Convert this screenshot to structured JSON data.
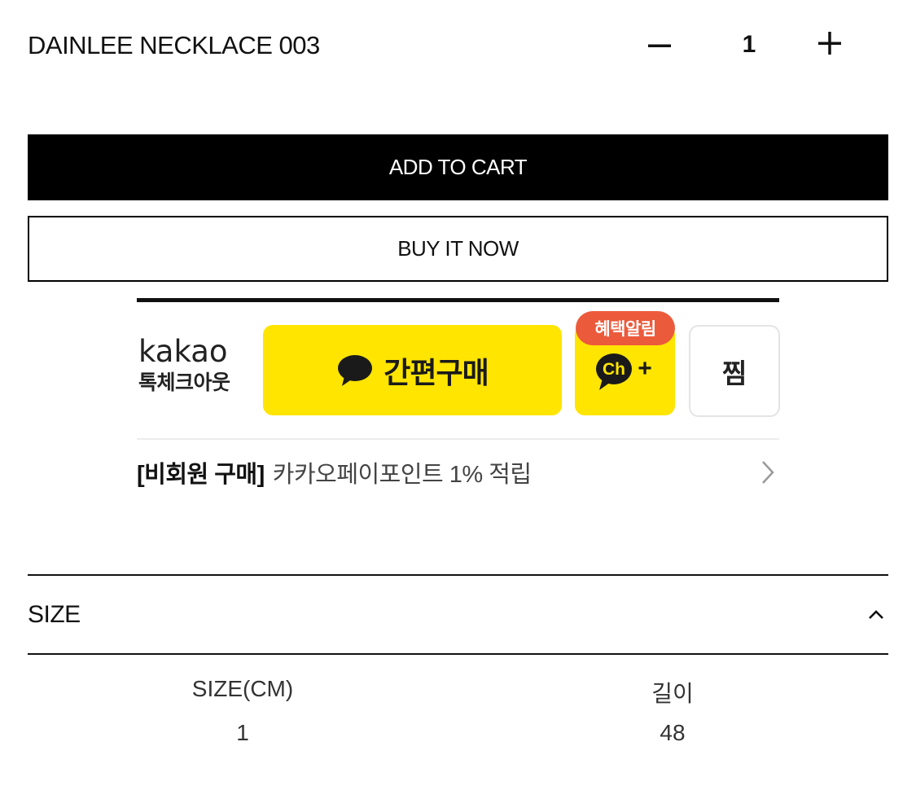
{
  "product": {
    "name": "DAINLEE NECKLACE 003",
    "quantity": "1",
    "minus_icon": "minus-icon",
    "plus_icon": "plus-icon"
  },
  "actions": {
    "add_to_cart_label": "ADD TO CART",
    "buy_now_label": "BUY IT NOW"
  },
  "kakao": {
    "logo_word": "kakao",
    "logo_sub": "톡체크아웃",
    "quick_buy_label": "간편구매",
    "channel_badge": "혜택알림",
    "channel_icon_text": "Ch",
    "channel_plus": "+",
    "wishlist_label": "찜",
    "point_strong": "[비회원 구매]",
    "point_text": "카카오페이포인트 1% 적립",
    "brand_yellow": "#ffe500",
    "badge_color": "#ec5a3c"
  },
  "size_section": {
    "title": "SIZE",
    "expanded": true,
    "table": {
      "headers": [
        "SIZE(CM)",
        "길이"
      ],
      "rows": [
        [
          "1",
          "48"
        ]
      ]
    }
  }
}
